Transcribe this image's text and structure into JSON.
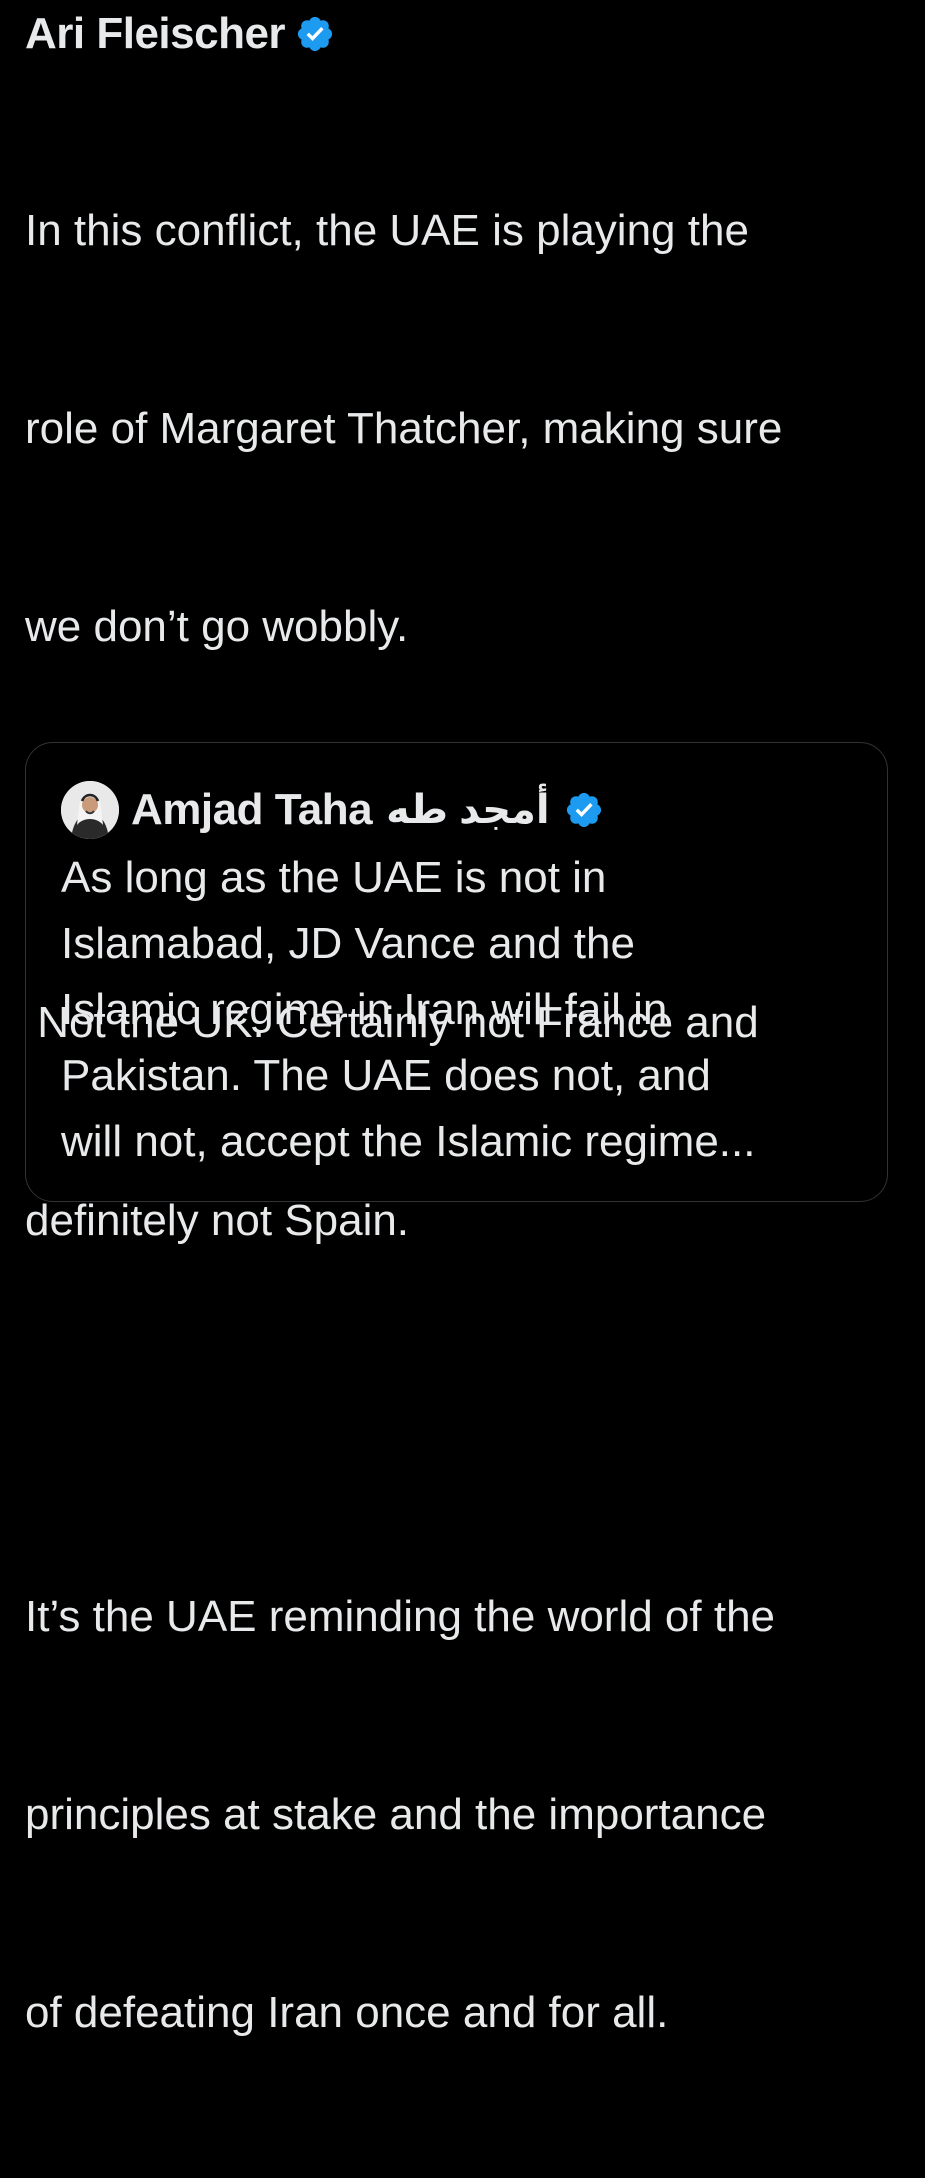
{
  "post": {
    "author_name": "Ari Fleischer",
    "verified_icon": "verified-badge-icon",
    "paragraphs": [
      [
        "In this conflict, the UAE is playing the",
        "role of Margaret Thatcher, making sure",
        "we don’t go wobbly."
      ],
      [
        " Not the UK. Certainly not France and",
        "definitely not Spain."
      ],
      [
        "It’s the UAE reminding the world of the",
        "principles at stake and the importance",
        "of defeating Iran once and for all."
      ]
    ]
  },
  "quote": {
    "author_name": "Amjad Taha",
    "author_name_arabic": "أمجد طه",
    "avatar_icon": "avatar-image",
    "verified_icon": "verified-badge-icon",
    "lines": [
      "As long as the UAE is not in",
      "Islamabad, JD Vance and the",
      "Islamic regime in Iran will fail in",
      "Pakistan. The UAE does not, and",
      "will not, accept the Islamic regime..."
    ]
  },
  "colors": {
    "background": "#000000",
    "text": "#e7e9ea",
    "verified_blue": "#1d9bf0",
    "border": "#2f3336"
  }
}
